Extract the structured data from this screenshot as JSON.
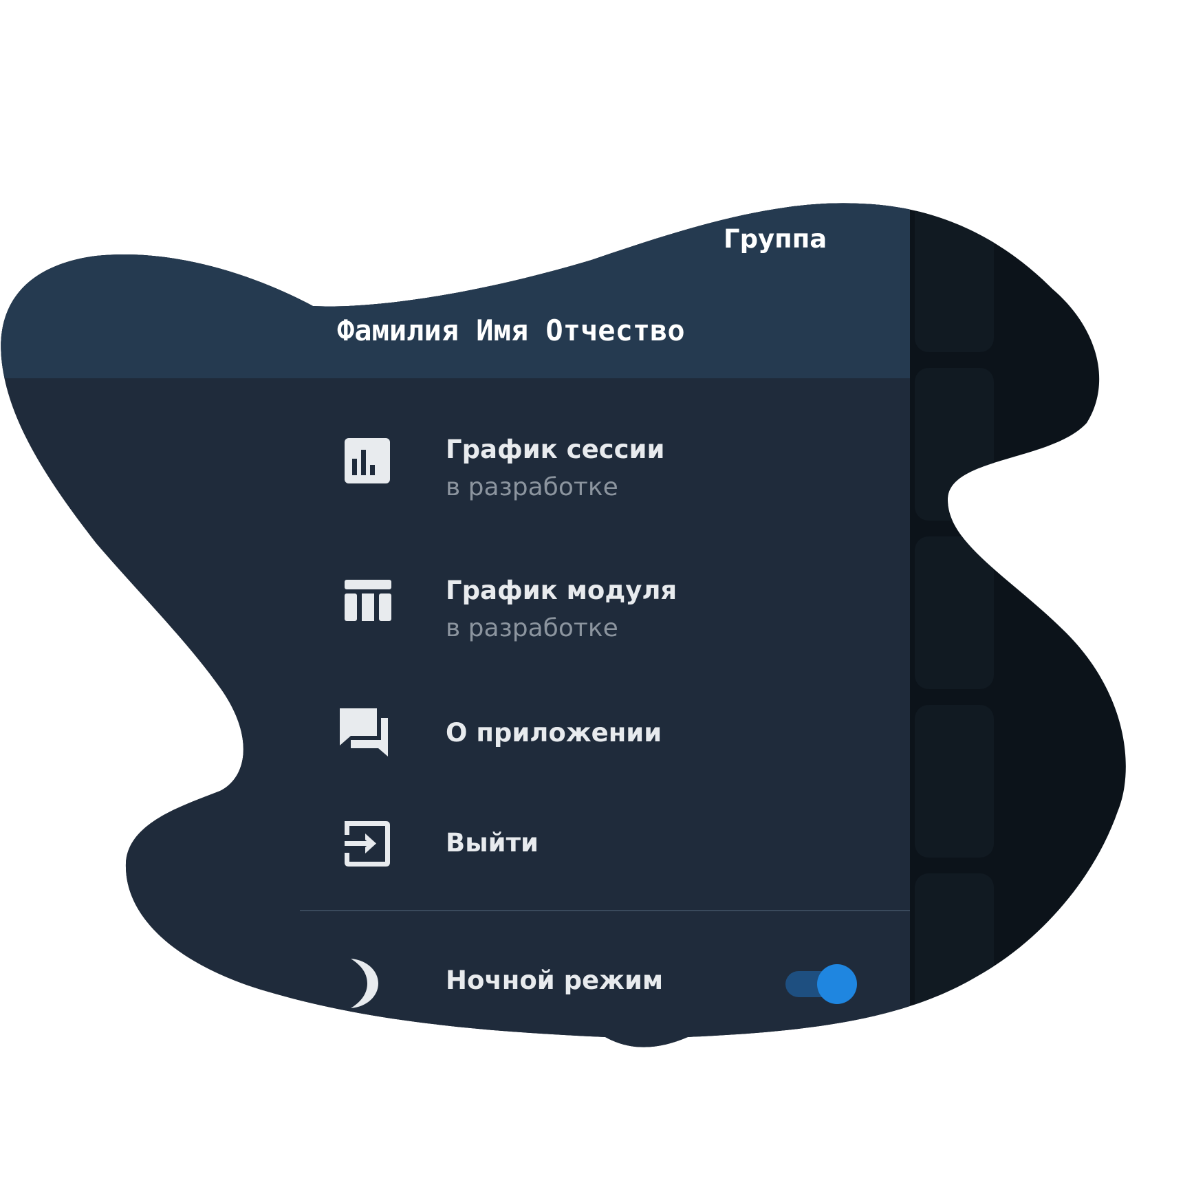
{
  "drawer": {
    "group_label": "Группа",
    "user_name": "Фамилия Имя Отчество",
    "items": [
      {
        "title": "График сессии",
        "subtitle": "в разработке",
        "icon": "bar-chart-icon"
      },
      {
        "title": "График модуля",
        "subtitle": "в разработке",
        "icon": "table-icon"
      },
      {
        "title": "О приложении",
        "icon": "forum-icon"
      },
      {
        "title": "Выйти",
        "icon": "exit-icon"
      }
    ],
    "night_mode": {
      "label": "Ночной режим",
      "icon": "moon-icon",
      "enabled": true
    }
  },
  "colors": {
    "header_bg": "#253a50",
    "drawer_bg": "#1f2b3b",
    "background_app": "#0c131a",
    "accent": "#1f86e0",
    "subtitle_text": "#8c959f"
  }
}
